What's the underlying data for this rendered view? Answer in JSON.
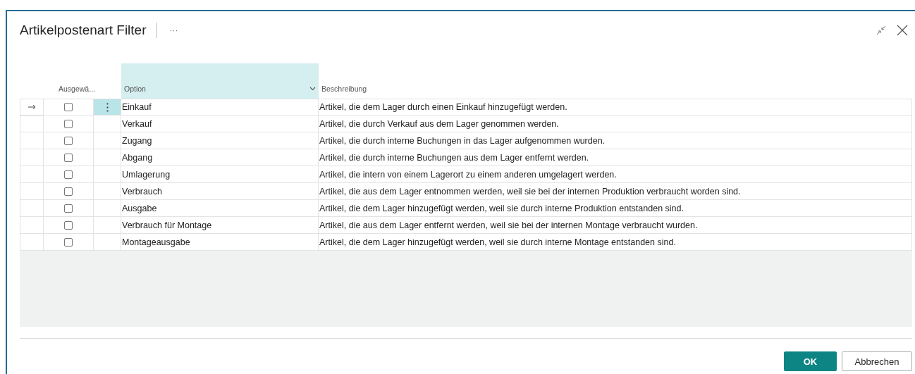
{
  "dialog": {
    "title": "Artikelpostenart Filter",
    "more_actions": "···"
  },
  "table": {
    "columns": [
      {
        "label": "Ausgewä...",
        "selected": false
      },
      {
        "label": "Option",
        "selected": true
      },
      {
        "label": "Beschreibung",
        "selected": false
      }
    ],
    "rows": [
      {
        "current": true,
        "checked": false,
        "option": "Einkauf",
        "description": "Artikel, die dem Lager durch einen Einkauf hinzugefügt werden."
      },
      {
        "current": false,
        "checked": false,
        "option": "Verkauf",
        "description": "Artikel, die durch Verkauf aus dem Lager genommen werden."
      },
      {
        "current": false,
        "checked": false,
        "option": "Zugang",
        "description": "Artikel, die durch interne Buchungen in das Lager aufgenommen wurden."
      },
      {
        "current": false,
        "checked": false,
        "option": "Abgang",
        "description": "Artikel, die durch interne Buchungen aus dem Lager entfernt werden."
      },
      {
        "current": false,
        "checked": false,
        "option": "Umlagerung",
        "description": "Artikel, die intern von einem Lagerort zu einem anderen umgelagert werden."
      },
      {
        "current": false,
        "checked": false,
        "option": "Verbrauch",
        "description": "Artikel, die aus dem Lager entnommen werden, weil sie bei der internen Produktion verbraucht worden sind."
      },
      {
        "current": false,
        "checked": false,
        "option": "Ausgabe",
        "description": "Artikel, die dem Lager hinzugefügt werden, weil sie durch interne Produktion entstanden sind."
      },
      {
        "current": false,
        "checked": false,
        "option": "Verbrauch für Montage",
        "description": "Artikel, die aus dem Lager entfernt werden, weil sie bei der internen Montage verbraucht wurden."
      },
      {
        "current": false,
        "checked": false,
        "option": "Montageausgabe",
        "description": "Artikel, die dem Lager hinzugefügt werden, weil sie durch interne Montage entstanden sind."
      }
    ]
  },
  "buttons": [
    {
      "label": "OK",
      "kind": "primary"
    },
    {
      "label": "Abbrechen",
      "kind": "secondary"
    }
  ]
}
